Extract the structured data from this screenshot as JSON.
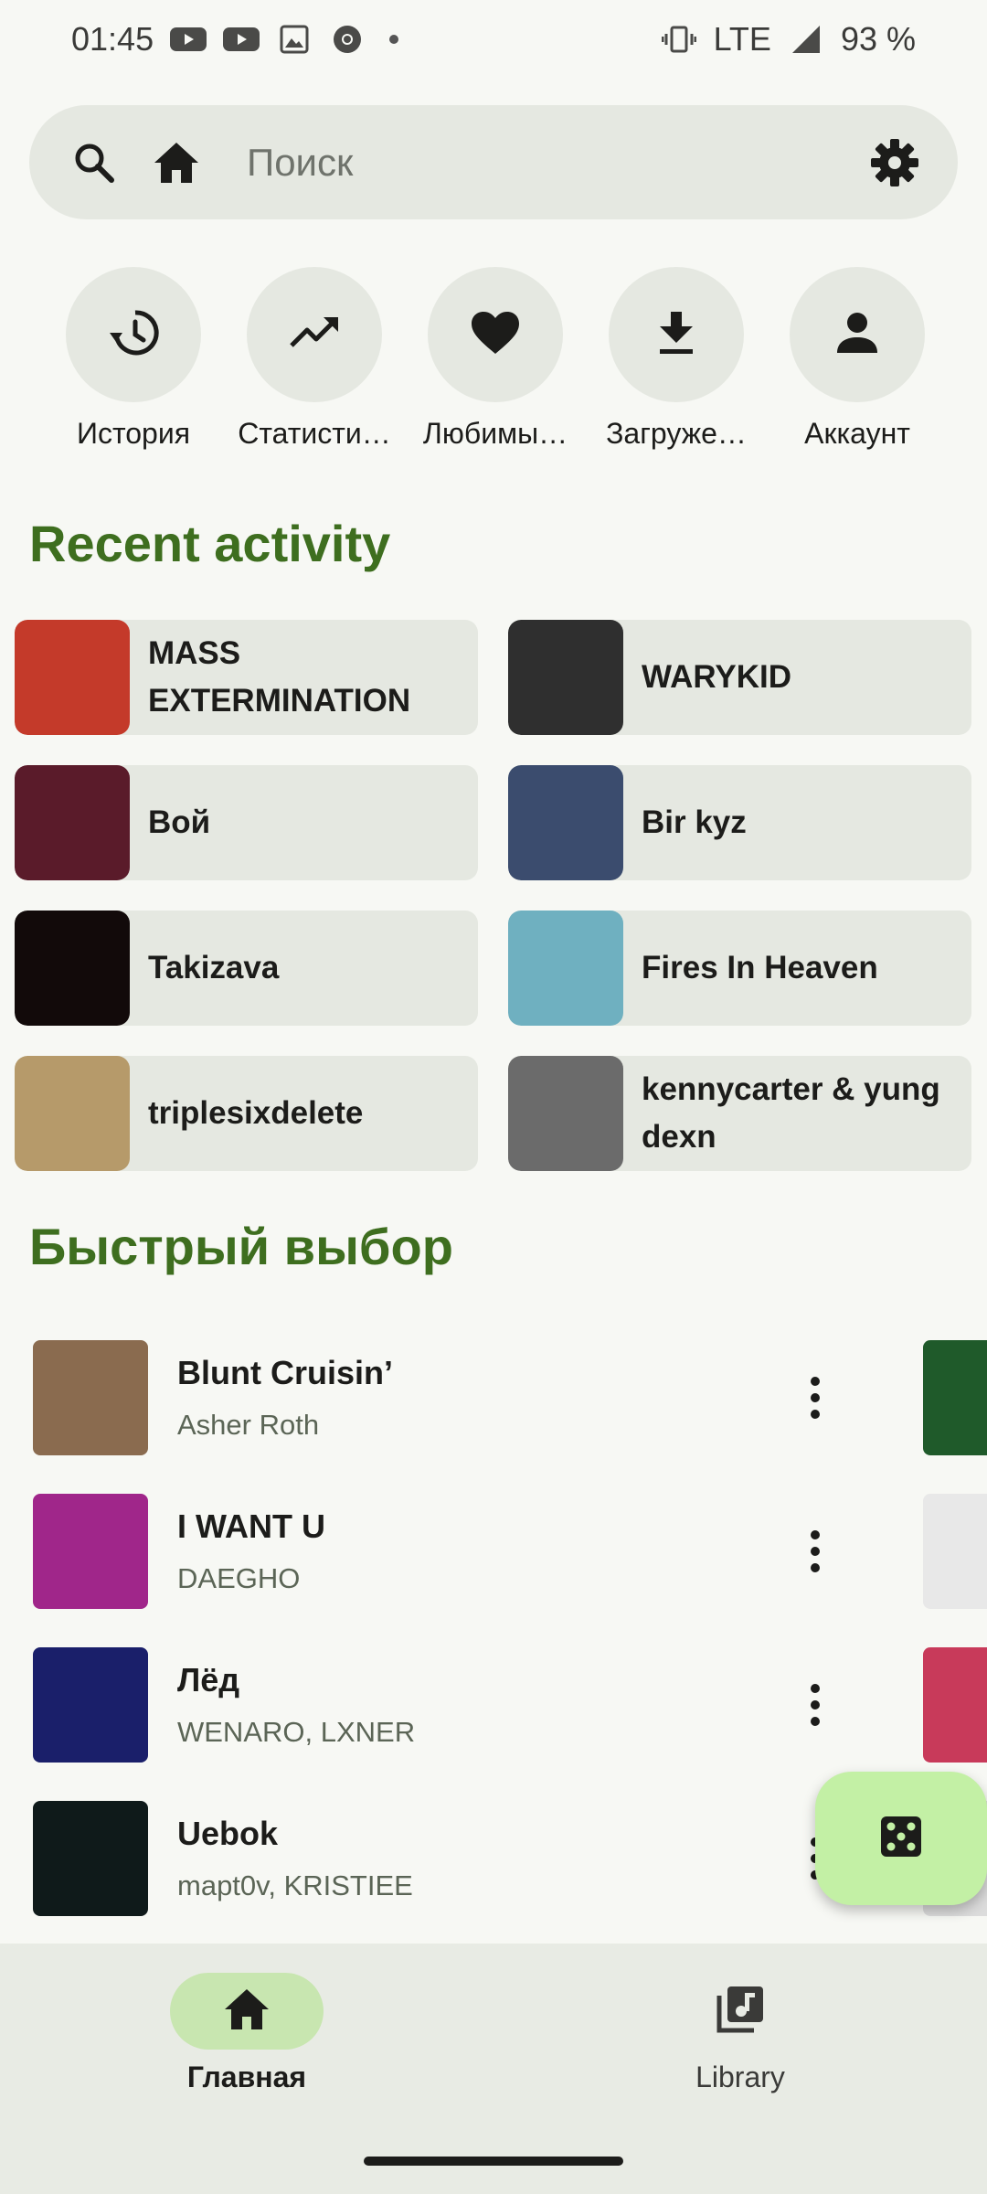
{
  "status_bar": {
    "time": "01:45",
    "network": "LTE",
    "battery": "93 %"
  },
  "search": {
    "placeholder": "Поиск"
  },
  "shortcuts": [
    {
      "label": "История",
      "icon": "history-icon"
    },
    {
      "label": "Статисти…",
      "icon": "trending-up-icon"
    },
    {
      "label": "Любимы…",
      "icon": "heart-icon"
    },
    {
      "label": "Загруже…",
      "icon": "download-icon"
    },
    {
      "label": "Аккаунт",
      "icon": "person-icon"
    }
  ],
  "recent": {
    "title": "Recent activity",
    "items": [
      {
        "title": "MASS EXTERMINATION",
        "color": "#c43a2a"
      },
      {
        "title": "WARYKID",
        "color": "#2f2f2f"
      },
      {
        "title": "Вой",
        "color": "#5a1b2a"
      },
      {
        "title": "Bir kyz",
        "color": "#3b4c6e"
      },
      {
        "title": "Takizava",
        "color": "#120a0a"
      },
      {
        "title": "Fires In Heaven",
        "color": "#6fb0c0"
      },
      {
        "title": "triplesixdelete",
        "color": "#b69a6a"
      },
      {
        "title": "kennycarter & yung dexn",
        "color": "#6b6b6b"
      }
    ]
  },
  "quick_pick": {
    "title": "Быстрый выбор",
    "items": [
      {
        "song": "Blunt Cruisin’",
        "artist": "Asher Roth",
        "color": "#8a6b4f",
        "peek": "#1f5a2a"
      },
      {
        "song": "I WANT U",
        "artist": "DAEGHO",
        "color": "#a0268a",
        "peek": "#e8e8e8"
      },
      {
        "song": "Лёд",
        "artist": "WENARO, LXNER",
        "color": "#1a1f6a",
        "peek": "#c83a5a"
      },
      {
        "song": "Uebok",
        "artist": "mapt0v, KRISTIEE",
        "color": "#0f1a1a",
        "peek": "#dcdcdc"
      }
    ]
  },
  "bottom_nav": {
    "home_label": "Главная",
    "library_label": "Library"
  },
  "colors": {
    "accent_title": "#3e6e1f",
    "fab": "#c3f0a5",
    "chip_bg": "#e5e8e1"
  }
}
